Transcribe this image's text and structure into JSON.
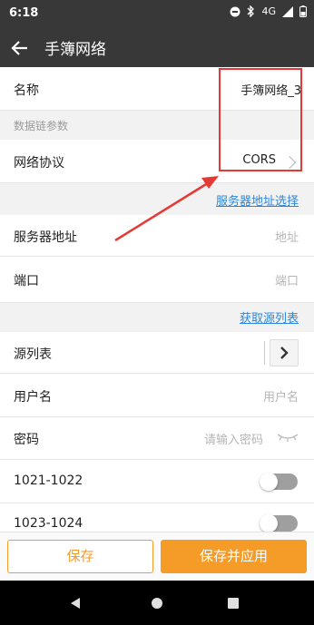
{
  "status_bar": {
    "time": "6:18",
    "network": "4G"
  },
  "app_bar": {
    "title": "手簿网络"
  },
  "form": {
    "name": {
      "label": "名称",
      "value": "手簿网络_3"
    },
    "section_datalink": "数据链参数",
    "protocol": {
      "label": "网络协议",
      "value": "CORS"
    },
    "server_select_link": "服务器地址选择",
    "server_address": {
      "label": "服务器地址",
      "placeholder": "地址"
    },
    "port": {
      "label": "端口",
      "placeholder": "端口"
    },
    "get_source_link": "获取源列表",
    "source_list": {
      "label": "源列表"
    },
    "username": {
      "label": "用户名",
      "placeholder": "用户名"
    },
    "password": {
      "label": "密码",
      "placeholder": "请输入密码"
    },
    "toggle_1": {
      "label": "1021-1022",
      "on": false
    },
    "toggle_2": {
      "label": "1023-1024",
      "on": false
    }
  },
  "footer": {
    "save_label": "保存",
    "save_apply_label": "保存并应用"
  },
  "colors": {
    "accent": "#f49b28",
    "link": "#2d86d9",
    "annotation": "#e53935",
    "bar": "#383838"
  }
}
